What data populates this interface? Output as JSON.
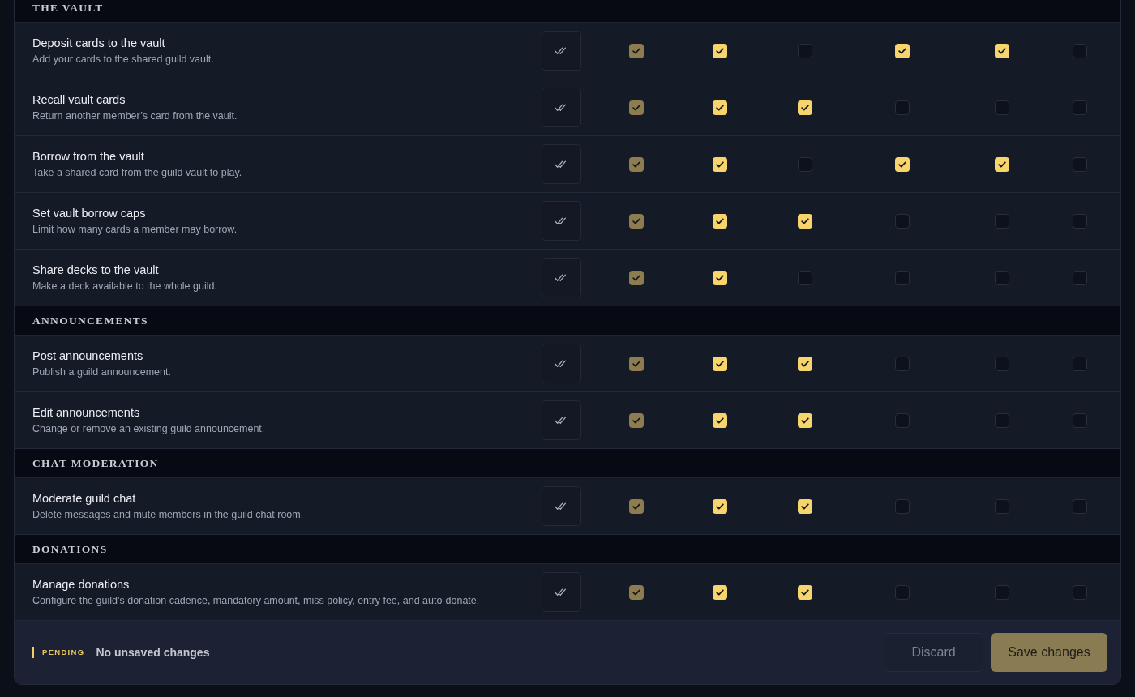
{
  "sections": [
    {
      "title": "THE VAULT",
      "rows": [
        {
          "title": "Deposit cards to the vault",
          "description": "Add your cards to the shared guild vault.",
          "checks": [
            {
              "checked": true,
              "disabled": true
            },
            {
              "checked": true,
              "disabled": false
            },
            {
              "checked": false,
              "disabled": false
            },
            {
              "checked": true,
              "disabled": false
            },
            {
              "checked": true,
              "disabled": false
            },
            {
              "checked": false,
              "disabled": false
            }
          ]
        },
        {
          "title": "Recall vault cards",
          "description": "Return another member’s card from the vault.",
          "checks": [
            {
              "checked": true,
              "disabled": true
            },
            {
              "checked": true,
              "disabled": false
            },
            {
              "checked": true,
              "disabled": false
            },
            {
              "checked": false,
              "disabled": false
            },
            {
              "checked": false,
              "disabled": false
            },
            {
              "checked": false,
              "disabled": false
            }
          ]
        },
        {
          "title": "Borrow from the vault",
          "description": "Take a shared card from the guild vault to play.",
          "checks": [
            {
              "checked": true,
              "disabled": true
            },
            {
              "checked": true,
              "disabled": false
            },
            {
              "checked": false,
              "disabled": false
            },
            {
              "checked": true,
              "disabled": false
            },
            {
              "checked": true,
              "disabled": false
            },
            {
              "checked": false,
              "disabled": false
            }
          ]
        },
        {
          "title": "Set vault borrow caps",
          "description": "Limit how many cards a member may borrow.",
          "checks": [
            {
              "checked": true,
              "disabled": true
            },
            {
              "checked": true,
              "disabled": false
            },
            {
              "checked": true,
              "disabled": false
            },
            {
              "checked": false,
              "disabled": false
            },
            {
              "checked": false,
              "disabled": false
            },
            {
              "checked": false,
              "disabled": false
            }
          ]
        },
        {
          "title": "Share decks to the vault",
          "description": "Make a deck available to the whole guild.",
          "checks": [
            {
              "checked": true,
              "disabled": true
            },
            {
              "checked": true,
              "disabled": false
            },
            {
              "checked": false,
              "disabled": false
            },
            {
              "checked": false,
              "disabled": false
            },
            {
              "checked": false,
              "disabled": false
            },
            {
              "checked": false,
              "disabled": false
            }
          ]
        }
      ]
    },
    {
      "title": "ANNOUNCEMENTS",
      "rows": [
        {
          "title": "Post announcements",
          "description": "Publish a guild announcement.",
          "checks": [
            {
              "checked": true,
              "disabled": true
            },
            {
              "checked": true,
              "disabled": false
            },
            {
              "checked": true,
              "disabled": false
            },
            {
              "checked": false,
              "disabled": false
            },
            {
              "checked": false,
              "disabled": false
            },
            {
              "checked": false,
              "disabled": false
            }
          ]
        },
        {
          "title": "Edit announcements",
          "description": "Change or remove an existing guild announcement.",
          "checks": [
            {
              "checked": true,
              "disabled": true
            },
            {
              "checked": true,
              "disabled": false
            },
            {
              "checked": true,
              "disabled": false
            },
            {
              "checked": false,
              "disabled": false
            },
            {
              "checked": false,
              "disabled": false
            },
            {
              "checked": false,
              "disabled": false
            }
          ]
        }
      ]
    },
    {
      "title": "CHAT MODERATION",
      "rows": [
        {
          "title": "Moderate guild chat",
          "description": "Delete messages and mute members in the guild chat room.",
          "checks": [
            {
              "checked": true,
              "disabled": true
            },
            {
              "checked": true,
              "disabled": false
            },
            {
              "checked": true,
              "disabled": false
            },
            {
              "checked": false,
              "disabled": false
            },
            {
              "checked": false,
              "disabled": false
            },
            {
              "checked": false,
              "disabled": false
            }
          ]
        }
      ]
    },
    {
      "title": "DONATIONS",
      "rows": [
        {
          "title": "Manage donations",
          "description": "Configure the guild’s donation cadence, mandatory amount, miss policy, entry fee, and auto-donate.",
          "checks": [
            {
              "checked": true,
              "disabled": true
            },
            {
              "checked": true,
              "disabled": false
            },
            {
              "checked": true,
              "disabled": false
            },
            {
              "checked": false,
              "disabled": false
            },
            {
              "checked": false,
              "disabled": false
            },
            {
              "checked": false,
              "disabled": false
            }
          ]
        }
      ]
    }
  ],
  "footer": {
    "status_label": "PENDING",
    "status_text": "No unsaved changes",
    "buttons": [
      {
        "label": "Discard",
        "kind": "secondary",
        "disabled": true
      },
      {
        "label": "Save changes",
        "kind": "primary",
        "disabled": true
      }
    ]
  }
}
